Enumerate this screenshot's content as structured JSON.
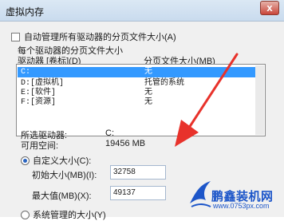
{
  "window": {
    "title": "虚拟内存",
    "close_glyph": "x"
  },
  "auto_manage": {
    "label": "自动管理所有驱动器的分页文件大小(A)",
    "checked": false
  },
  "group": {
    "label": "每个驱动器的分页文件大小"
  },
  "list": {
    "headers": {
      "drive": "驱动器 [卷标](D)",
      "size": "分页文件大小(MB)"
    },
    "rows": [
      {
        "letter": "C:",
        "label": "",
        "size": "无",
        "selected": true
      },
      {
        "letter": "D:",
        "label": "[虚拟机]",
        "size": "托管的系统",
        "selected": false
      },
      {
        "letter": "E:",
        "label": "[软件]",
        "size": "无",
        "selected": false
      },
      {
        "letter": "F:",
        "label": "[资源]",
        "size": "无",
        "selected": false
      }
    ]
  },
  "selected_drive": {
    "drive_label": "所选驱动器:",
    "drive_value": "C:",
    "space_label": "可用空间:",
    "space_value": "19456 MB"
  },
  "custom_size": {
    "label": "自定义大小(C):",
    "selected": true,
    "initial_label": "初始大小(MB)(I):",
    "initial_value": "32758",
    "max_label": "最大值(MB)(X):",
    "max_value": "49137"
  },
  "system_managed": {
    "label": "系统管理的大小(Y)",
    "selected": false
  },
  "watermark": {
    "title": "鹏鑫装机网",
    "url": "www.0753px.com",
    "color": "#1d56c9"
  },
  "colors": {
    "arrow": "#e8322b",
    "selection": "#3399ff"
  }
}
